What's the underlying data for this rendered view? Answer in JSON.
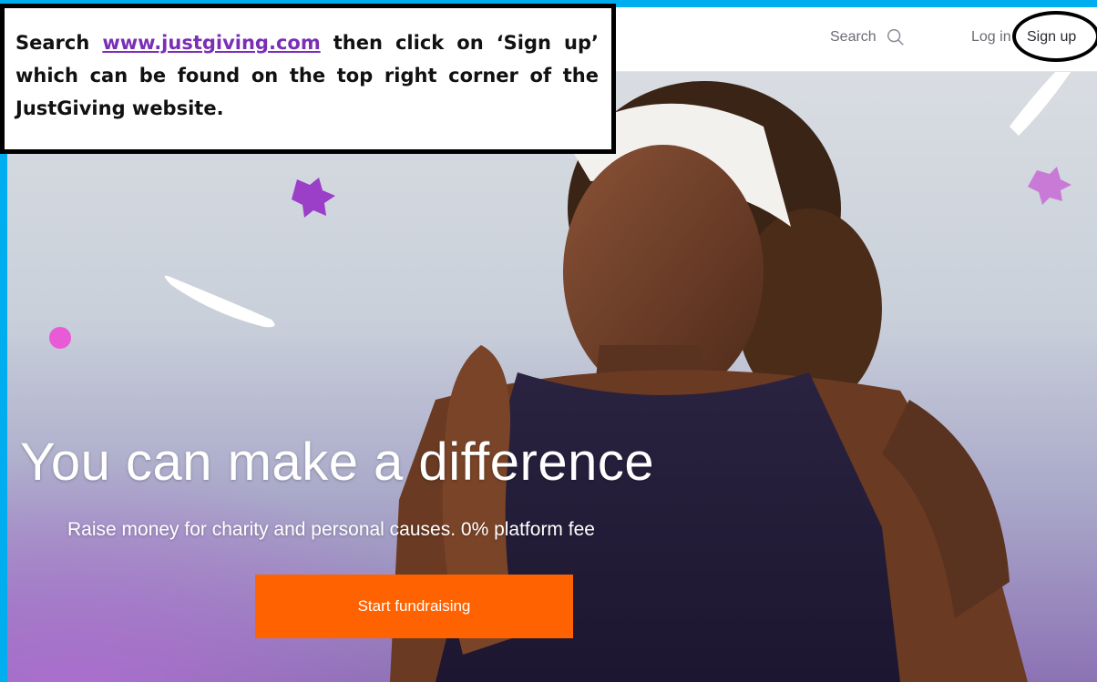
{
  "nav": {
    "search_label": "Search",
    "login_label": "Log in",
    "signup_label": "Sign up"
  },
  "hero": {
    "title": "You can make a difference",
    "subtitle": "Raise money for charity and personal causes. 0% platform fee",
    "cta_label": "Start fundraising"
  },
  "callout": {
    "prefix": "Search",
    "link_text": "www.justgiving.com",
    "suffix": "then click on ‘Sign up’ which can be found on the top right corner of the JustGiving website."
  },
  "icons": {
    "search": "search-icon"
  },
  "colors": {
    "frame": "#00aeef",
    "cta": "#ff6200",
    "link": "#7a2fb5",
    "annotation": "#000000"
  }
}
